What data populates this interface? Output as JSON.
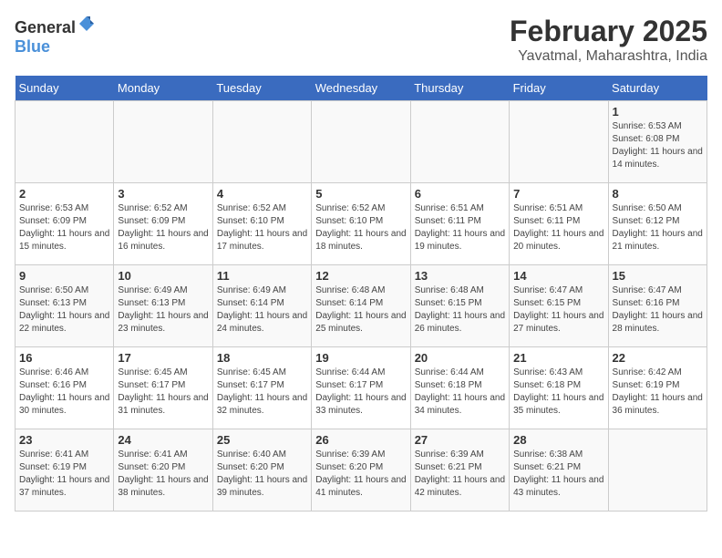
{
  "header": {
    "logo": {
      "text_general": "General",
      "text_blue": "Blue"
    },
    "title": "February 2025",
    "location": "Yavatmal, Maharashtra, India"
  },
  "calendar": {
    "days_of_week": [
      "Sunday",
      "Monday",
      "Tuesday",
      "Wednesday",
      "Thursday",
      "Friday",
      "Saturday"
    ],
    "weeks": [
      [
        {
          "day": "",
          "info": ""
        },
        {
          "day": "",
          "info": ""
        },
        {
          "day": "",
          "info": ""
        },
        {
          "day": "",
          "info": ""
        },
        {
          "day": "",
          "info": ""
        },
        {
          "day": "",
          "info": ""
        },
        {
          "day": "1",
          "info": "Sunrise: 6:53 AM\nSunset: 6:08 PM\nDaylight: 11 hours and 14 minutes."
        }
      ],
      [
        {
          "day": "2",
          "info": "Sunrise: 6:53 AM\nSunset: 6:09 PM\nDaylight: 11 hours and 15 minutes."
        },
        {
          "day": "3",
          "info": "Sunrise: 6:52 AM\nSunset: 6:09 PM\nDaylight: 11 hours and 16 minutes."
        },
        {
          "day": "4",
          "info": "Sunrise: 6:52 AM\nSunset: 6:10 PM\nDaylight: 11 hours and 17 minutes."
        },
        {
          "day": "5",
          "info": "Sunrise: 6:52 AM\nSunset: 6:10 PM\nDaylight: 11 hours and 18 minutes."
        },
        {
          "day": "6",
          "info": "Sunrise: 6:51 AM\nSunset: 6:11 PM\nDaylight: 11 hours and 19 minutes."
        },
        {
          "day": "7",
          "info": "Sunrise: 6:51 AM\nSunset: 6:11 PM\nDaylight: 11 hours and 20 minutes."
        },
        {
          "day": "8",
          "info": "Sunrise: 6:50 AM\nSunset: 6:12 PM\nDaylight: 11 hours and 21 minutes."
        }
      ],
      [
        {
          "day": "9",
          "info": "Sunrise: 6:50 AM\nSunset: 6:13 PM\nDaylight: 11 hours and 22 minutes."
        },
        {
          "day": "10",
          "info": "Sunrise: 6:49 AM\nSunset: 6:13 PM\nDaylight: 11 hours and 23 minutes."
        },
        {
          "day": "11",
          "info": "Sunrise: 6:49 AM\nSunset: 6:14 PM\nDaylight: 11 hours and 24 minutes."
        },
        {
          "day": "12",
          "info": "Sunrise: 6:48 AM\nSunset: 6:14 PM\nDaylight: 11 hours and 25 minutes."
        },
        {
          "day": "13",
          "info": "Sunrise: 6:48 AM\nSunset: 6:15 PM\nDaylight: 11 hours and 26 minutes."
        },
        {
          "day": "14",
          "info": "Sunrise: 6:47 AM\nSunset: 6:15 PM\nDaylight: 11 hours and 27 minutes."
        },
        {
          "day": "15",
          "info": "Sunrise: 6:47 AM\nSunset: 6:16 PM\nDaylight: 11 hours and 28 minutes."
        }
      ],
      [
        {
          "day": "16",
          "info": "Sunrise: 6:46 AM\nSunset: 6:16 PM\nDaylight: 11 hours and 30 minutes."
        },
        {
          "day": "17",
          "info": "Sunrise: 6:45 AM\nSunset: 6:17 PM\nDaylight: 11 hours and 31 minutes."
        },
        {
          "day": "18",
          "info": "Sunrise: 6:45 AM\nSunset: 6:17 PM\nDaylight: 11 hours and 32 minutes."
        },
        {
          "day": "19",
          "info": "Sunrise: 6:44 AM\nSunset: 6:17 PM\nDaylight: 11 hours and 33 minutes."
        },
        {
          "day": "20",
          "info": "Sunrise: 6:44 AM\nSunset: 6:18 PM\nDaylight: 11 hours and 34 minutes."
        },
        {
          "day": "21",
          "info": "Sunrise: 6:43 AM\nSunset: 6:18 PM\nDaylight: 11 hours and 35 minutes."
        },
        {
          "day": "22",
          "info": "Sunrise: 6:42 AM\nSunset: 6:19 PM\nDaylight: 11 hours and 36 minutes."
        }
      ],
      [
        {
          "day": "23",
          "info": "Sunrise: 6:41 AM\nSunset: 6:19 PM\nDaylight: 11 hours and 37 minutes."
        },
        {
          "day": "24",
          "info": "Sunrise: 6:41 AM\nSunset: 6:20 PM\nDaylight: 11 hours and 38 minutes."
        },
        {
          "day": "25",
          "info": "Sunrise: 6:40 AM\nSunset: 6:20 PM\nDaylight: 11 hours and 39 minutes."
        },
        {
          "day": "26",
          "info": "Sunrise: 6:39 AM\nSunset: 6:20 PM\nDaylight: 11 hours and 41 minutes."
        },
        {
          "day": "27",
          "info": "Sunrise: 6:39 AM\nSunset: 6:21 PM\nDaylight: 11 hours and 42 minutes."
        },
        {
          "day": "28",
          "info": "Sunrise: 6:38 AM\nSunset: 6:21 PM\nDaylight: 11 hours and 43 minutes."
        },
        {
          "day": "",
          "info": ""
        }
      ]
    ]
  }
}
